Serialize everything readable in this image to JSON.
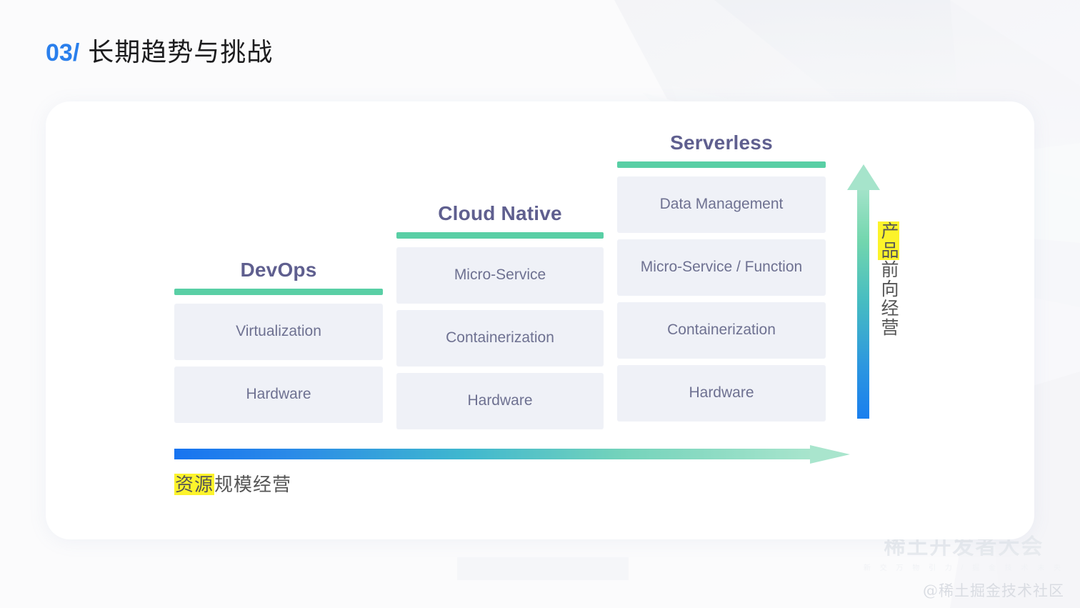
{
  "slide": {
    "title_number": "03/",
    "title_text": "长期趋势与挑战"
  },
  "diagram": {
    "type": "stacked-maturity-columns",
    "columns": [
      {
        "header": "DevOps",
        "boxes": [
          "Virtualization",
          "Hardware"
        ]
      },
      {
        "header": "Cloud Native",
        "boxes": [
          "Micro-Service",
          "Containerization",
          "Hardware"
        ]
      },
      {
        "header": "Serverless",
        "boxes": [
          "Data Management",
          "Micro-Service / Function",
          "Containerization",
          "Hardware"
        ]
      }
    ],
    "horizontal_axis": {
      "label_highlight": "资源",
      "label_rest": "规模经营",
      "direction": "left-to-right",
      "gradient_from": "#1e7ff0",
      "gradient_to": "#9ee2c6"
    },
    "vertical_axis": {
      "label_highlight": "产品",
      "label_rest": "前向经营",
      "direction": "bottom-to-top",
      "gradient_from": "#1e88e8",
      "gradient_to": "#9fe2c8"
    },
    "accent_rule_color": "#59cfa5",
    "box_fill_color": "#eff1f7",
    "box_text_color": "#6e7191",
    "header_text_color": "#5f5f8f",
    "highlight_color": "#fcf32b"
  },
  "watermark": {
    "logo_main": "稀土开发者大会",
    "logo_sub": "新 交 万 物 引 力 / 掘 金 技 术 未 央",
    "handle": "@稀土掘金技术社区"
  }
}
